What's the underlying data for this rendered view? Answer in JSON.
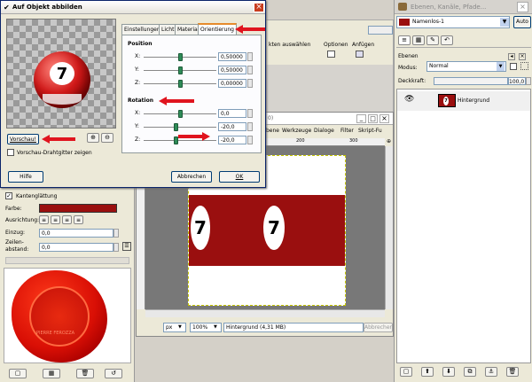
{
  "dialog": {
    "title": "Auf Objekt abbilden",
    "tabs": [
      "Einstellungen",
      "Licht",
      "Material",
      "Orientierung"
    ],
    "position_heading": "Position",
    "position_rows": [
      {
        "axis": "X:",
        "value": "0,50000",
        "fraction": 0.5
      },
      {
        "axis": "Y:",
        "value": "0,50000",
        "fraction": 0.5
      },
      {
        "axis": "Z:",
        "value": "0,00000",
        "fraction": 0.5
      }
    ],
    "rotation_heading": "Rotation",
    "rotation_rows": [
      {
        "axis": "X:",
        "value": "0,0",
        "fraction": 0.5
      },
      {
        "axis": "Y:",
        "value": "-20,0",
        "fraction": 0.44
      },
      {
        "axis": "Z:",
        "value": "-20,0",
        "fraction": 0.44
      }
    ],
    "preview_button": "Vorschau!",
    "wireframe_label": "Vorschau-Drahtgitter zeigen",
    "help_button": "Hilfe",
    "cancel_button": "Abbrechen",
    "ok_button": "OK",
    "ball_number": "7"
  },
  "bg_window": {
    "menu_fragment": "kten auswählen",
    "toolbar_items": [
      "Optionen",
      "Anfügen"
    ]
  },
  "image_window": {
    "title_fragment": "0)",
    "menu": [
      "bene",
      "Werkzeuge",
      "Dialoge",
      "Filter",
      "Skript-Fu"
    ],
    "ruler_labels": [
      "200",
      "300"
    ],
    "unit": "px",
    "zoom": "100%",
    "status": "Hintergrund (4,31 MB)",
    "cancel": "Abbrechen",
    "ball_numbers": [
      "7",
      "7"
    ]
  },
  "tool_options": {
    "antialias_label": "Kantenglättung",
    "color_label": "Farbe:",
    "color_value": "#9a0f0f",
    "justify_label": "Ausrichtung:",
    "indent_label": "Einzug:",
    "indent_value": "0,0",
    "line_spacing_label_1": "Zeilen-",
    "line_spacing_label_2": "abstand:",
    "line_spacing_value": "0,0",
    "seal_text": "PIERRE FEROZZA"
  },
  "layers_panel": {
    "window_title": "Ebenen, Kanäle, Pfade...",
    "image_name": "Namenlos-1",
    "auto_button": "Auto",
    "section_title": "Ebenen",
    "mode_label": "Modus:",
    "mode_value": "Normal",
    "opacity_label": "Deckkraft:",
    "opacity_value": "100,0",
    "layer_name": "Hintergrund",
    "layer_thumb_number": "7"
  }
}
